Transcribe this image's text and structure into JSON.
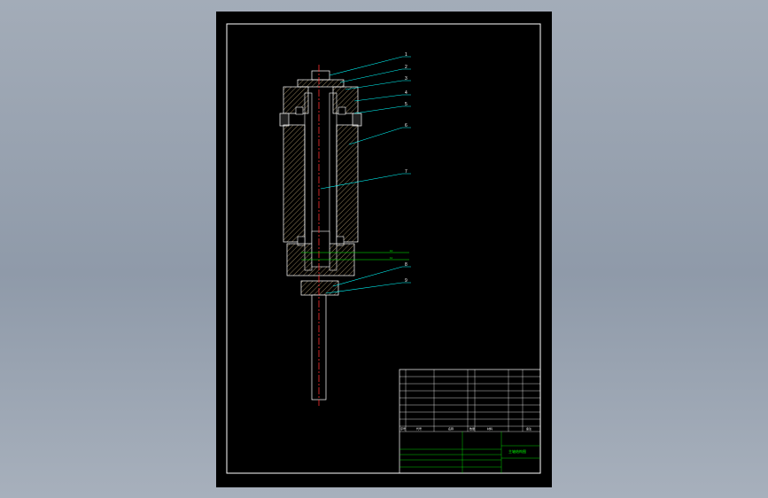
{
  "drawing": {
    "part_labels": [
      "1",
      "2",
      "3",
      "4",
      "5",
      "6",
      "7",
      "8",
      "9"
    ],
    "green_labels": [
      "10",
      "11"
    ]
  },
  "title_block": {
    "header_cells": [
      "序号",
      "代号",
      "名称",
      "数量",
      "材料",
      "备注"
    ],
    "title": "主轴结构图",
    "colors": {
      "line": "#00ff00",
      "cyan": "#00ffff",
      "red": "#ff3030",
      "hatch": "#b8a070"
    }
  }
}
